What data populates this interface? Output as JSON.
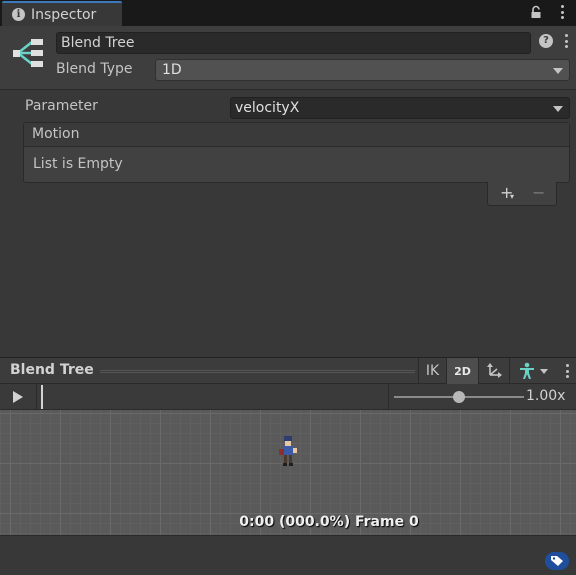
{
  "tab": {
    "title": "Inspector",
    "icon": "info-icon"
  },
  "header": {
    "name_value": "Blend Tree",
    "blend_type_label": "Blend Type",
    "blend_type_value": "1D",
    "help_icon": "help-icon"
  },
  "parameter": {
    "label": "Parameter",
    "value": "velocityX"
  },
  "motion_list": {
    "header": "Motion",
    "empty_text": "List is Empty",
    "add_label": "+",
    "remove_label": "−"
  },
  "preview": {
    "title": "Blend Tree",
    "ik_label": "IK",
    "mode_label": "2D",
    "speed_label": "1.00x",
    "speed_fraction": 0.5,
    "frame_readout": "0:00 (000.0%) Frame 0"
  },
  "colors": {
    "accent": "#3a79bb",
    "panel_bg": "#383838",
    "blend_tree_icon": "#6ad3c6",
    "tag_badge": "#1f4f9c"
  }
}
